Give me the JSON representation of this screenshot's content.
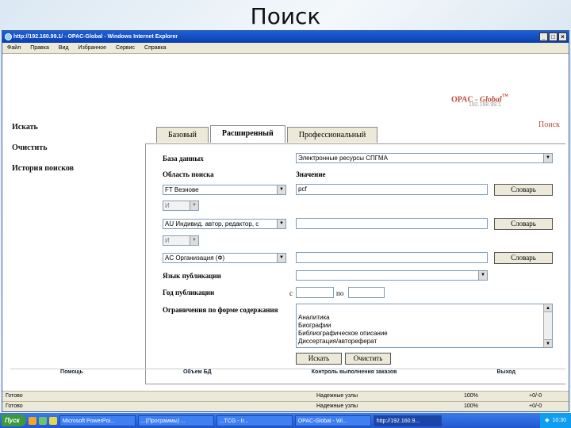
{
  "slide": {
    "title": "Поиск"
  },
  "window": {
    "title": "http://192.160.99.1/ - OPAC-Global - Windows Internet Explorer"
  },
  "menu": [
    "Файл",
    "Правка",
    "Вид",
    "Избранное",
    "Сервис",
    "Справка"
  ],
  "logo": {
    "text": "OPAC - ",
    "brand": "Global",
    "sup": "™",
    "ip": "192.168.99.1"
  },
  "left_nav": [
    "Искать",
    "Очистить",
    "История поисков"
  ],
  "search_link": "Поиск",
  "tabs": [
    "Базовый",
    "Расширенный",
    "Профессиональный"
  ],
  "form": {
    "db_label": "База данных",
    "db_value": "Электронные ресурсы СПГМА",
    "area_label": "Область поиска",
    "value_label": "Значение",
    "field1": "FT Везнове",
    "value1": "pcf",
    "op1": "И",
    "field2": "AU Индивид. автор, редактор, с",
    "value2": "",
    "op2": "И",
    "field3": "AC Организация (Ф)",
    "value3": "",
    "dict_btn": "Словарь",
    "lang_label": "Язык публикации",
    "lang_value": "",
    "year_label": "Год публикации",
    "from": "с",
    "to": "по",
    "restrict_label": "Ограничения по форме содержания",
    "restrict_options": [
      "Аналитика",
      "Биографии",
      "Библиографическое описание",
      "Диссертация/автореферат"
    ],
    "search_btn": "Искать",
    "clear_btn": "Очистить"
  },
  "footer_nav": [
    "Помощь",
    "Объем БД",
    "Контроль выполнения заказов",
    "Выход"
  ],
  "status": [
    {
      "left": "Готово",
      "zone": "Надежные узлы",
      "zoom": "100%",
      "ver": "+0/-0"
    },
    {
      "left": "Готово",
      "zone": "Надежные узлы",
      "zoom": "100%",
      "ver": "+0/-0"
    }
  ],
  "taskbar": {
    "start": "Пуск",
    "tasks": [
      "Microsoft PowerPoi...",
      "...(Программы) ...",
      "...TCG - Ir...",
      "OPAC-Global - Wi...",
      "http://192.160.9..."
    ],
    "clock": "10:30"
  }
}
